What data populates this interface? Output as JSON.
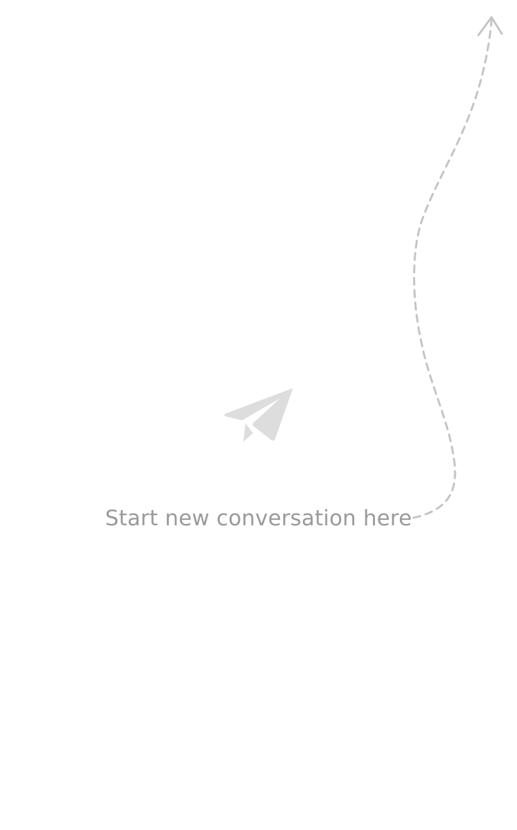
{
  "empty_state": {
    "message": "Start new conversation here",
    "icon": "paper-plane-icon",
    "hint_arrow_icon": "dashed-curved-arrow-icon"
  },
  "colors": {
    "background": "#ffffff",
    "message_text": "#9a9a9a",
    "icon_fill": "#dddddd",
    "arrow_stroke": "#c4c4c4"
  }
}
